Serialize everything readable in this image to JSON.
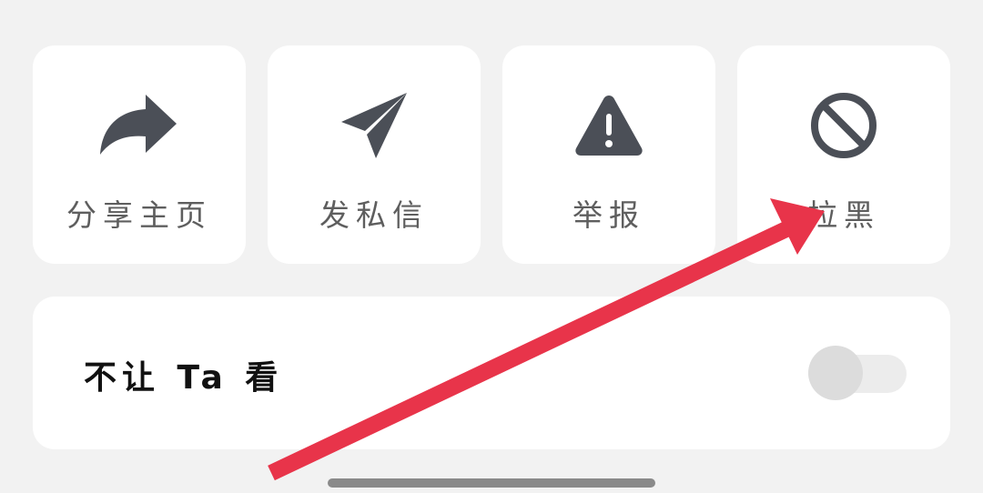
{
  "actions": {
    "share": {
      "label": "分享主页",
      "icon": "share-arrow-icon"
    },
    "message": {
      "label": "发私信",
      "icon": "paper-plane-icon"
    },
    "report": {
      "label": "举报",
      "icon": "warning-triangle-icon"
    },
    "block": {
      "label": "拉黑",
      "icon": "block-circle-icon"
    }
  },
  "privacy": {
    "hide_from_label": "不让 Ta 看",
    "hide_from_enabled": false
  },
  "colors": {
    "icon": "#4b4f57",
    "card": "#ffffff",
    "background": "#f2f2f2",
    "annotation_arrow": "#e8344a"
  }
}
